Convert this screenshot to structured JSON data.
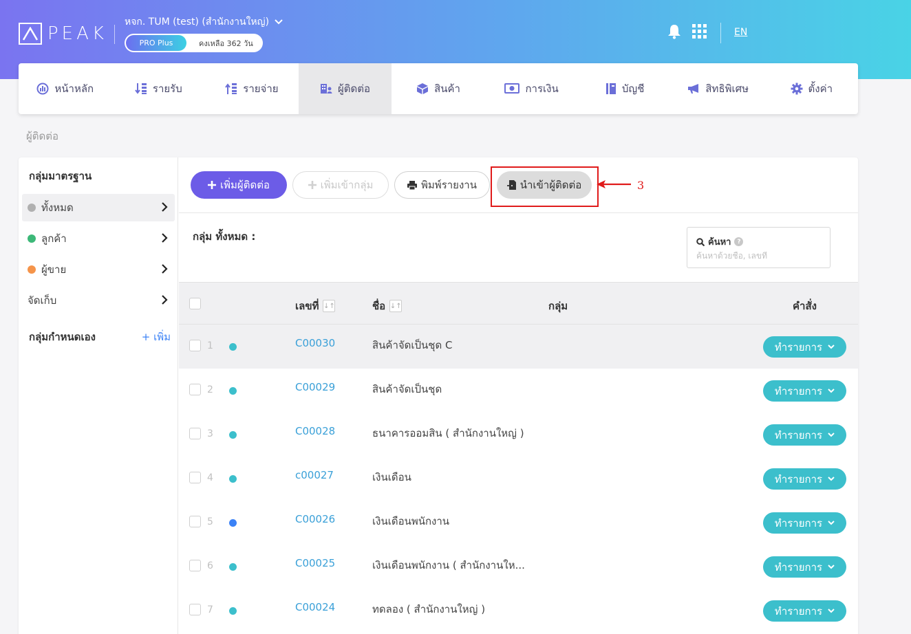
{
  "header": {
    "logo_text": "PEAK",
    "company": "หจก. TUM (test) (สำนักงานใหญ่)",
    "plan": "PRO Plus",
    "days_left": "คงเหลือ 362 วัน",
    "language": "EN"
  },
  "menu": [
    {
      "label": "หน้าหลัก",
      "icon": "dashboard-icon"
    },
    {
      "label": "รายรับ",
      "icon": "income-icon"
    },
    {
      "label": "รายจ่าย",
      "icon": "expense-icon"
    },
    {
      "label": "ผู้ติดต่อ",
      "icon": "contacts-icon",
      "active": true
    },
    {
      "label": "สินค้า",
      "icon": "box-icon"
    },
    {
      "label": "การเงิน",
      "icon": "money-icon"
    },
    {
      "label": "บัญชี",
      "icon": "book-icon"
    },
    {
      "label": "สิทธิพิเศษ",
      "icon": "megaphone-icon"
    },
    {
      "label": "ตั้งค่า",
      "icon": "gear-icon"
    }
  ],
  "breadcrumb": "ผู้ติดต่อ",
  "sidebar": {
    "standard_title": "กลุ่มมาตรฐาน",
    "items": [
      {
        "label": "ทั้งหมด",
        "color": "#b0b0b0"
      },
      {
        "label": "ลูกค้า",
        "color": "#3cb878"
      },
      {
        "label": "ผู้ขาย",
        "color": "#f5944a"
      },
      {
        "label": "จัดเก็บ",
        "color": ""
      }
    ],
    "custom_title": "กลุ่มกำหนดเอง",
    "add_label": "+ เพิ่ม"
  },
  "toolbar": {
    "add_contact": "เพิ่มผู้ติดต่อ",
    "add_to_group": "เพิ่มเข้ากลุ่ม",
    "print_report": "พิมพ์รายงาน",
    "import_contacts": "นำเข้าผู้ติดต่อ",
    "annotation_number": "3"
  },
  "group_label": "กลุ่ม ทั้งหมด :",
  "search": {
    "label": "ค้นหา",
    "placeholder": "ค้นหาด้วยชื่อ, เลขที่"
  },
  "table": {
    "headers": {
      "number": "เลขที่",
      "name": "ชื่อ",
      "group": "กลุ่ม",
      "command": "คำสั่ง"
    },
    "action_label": "ทำรายการ",
    "rows": [
      {
        "num": "1",
        "code": "C00030",
        "name": "สินค้าจัดเป็นชุด C",
        "dot": "#3cbfcc"
      },
      {
        "num": "2",
        "code": "C00029",
        "name": "สินค้าจัดเป็นชุด",
        "dot": "#3cbfcc"
      },
      {
        "num": "3",
        "code": "C00028",
        "name": "ธนาคารออมสิน ( สำนักงานใหญ่ )",
        "dot": "#3cbfcc"
      },
      {
        "num": "4",
        "code": "c00027",
        "name": "เงินเดือน",
        "dot": "#3cbfcc"
      },
      {
        "num": "5",
        "code": "C00026",
        "name": "เงินเดือนพนักงาน",
        "dot": "#3b82f6"
      },
      {
        "num": "6",
        "code": "C00025",
        "name": "เงินเดือนพนักงาน ( สำนักงานให...",
        "dot": "#3cbfcc"
      },
      {
        "num": "7",
        "code": "C00024",
        "name": "ทดลอง ( สำนักงานใหญ่ )",
        "dot": "#3cbfcc"
      }
    ]
  }
}
